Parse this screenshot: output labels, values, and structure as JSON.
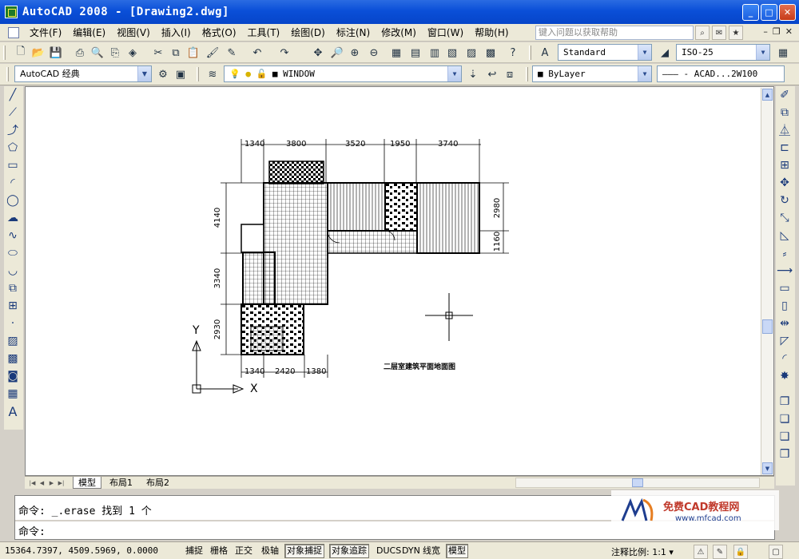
{
  "window": {
    "title": "AutoCAD 2008 - [Drawing2.dwg]",
    "min_glyph": "_",
    "max_glyph": "□",
    "close_glyph": "✕"
  },
  "menu": {
    "items": [
      "文件(F)",
      "编辑(E)",
      "视图(V)",
      "插入(I)",
      "格式(O)",
      "工具(T)",
      "绘图(D)",
      "标注(N)",
      "修改(M)",
      "窗口(W)",
      "帮助(H)"
    ],
    "help_placeholder": "键入问题以获取帮助",
    "doc_controls": [
      "–",
      "❐",
      "✕"
    ]
  },
  "toolbar1": {
    "text_style": "Standard",
    "dim_style": "ISO-25"
  },
  "toolbar2": {
    "workspace": "AutoCAD 经典",
    "layer": "WINDOW",
    "color": "ByLayer",
    "linetype": "——— - ACAD...2W100"
  },
  "drawing": {
    "top_dims": [
      "1340",
      "3800",
      "3520",
      "1950",
      "3740"
    ],
    "bottom_dims": [
      "1340",
      "2420",
      "1380"
    ],
    "left_dims": [
      "4140",
      "3340",
      "2930"
    ],
    "right_dims": [
      "2980",
      "1160"
    ],
    "plan_title": "二层室建筑平面地面图",
    "ucs_x": "X",
    "ucs_y": "Y"
  },
  "layout_tabs": [
    "模型",
    "布局1",
    "布局2"
  ],
  "command": {
    "line1": "命令:  _.erase 找到 1 个",
    "line2": "命令:"
  },
  "watermark": {
    "title": "免费CAD教程网",
    "url": "www.mfcad.com"
  },
  "status": {
    "coords": "15364.7397, 4509.5969, 0.0000",
    "toggles": [
      {
        "label": "捕捉",
        "on": false
      },
      {
        "label": "栅格",
        "on": false
      },
      {
        "label": "正交",
        "on": false
      },
      {
        "label": "极轴",
        "on": false
      },
      {
        "label": "对象捕捉",
        "on": true
      },
      {
        "label": "对象追踪",
        "on": true
      },
      {
        "label": "DUCS",
        "on": false
      },
      {
        "label": "DYN",
        "on": false
      },
      {
        "label": "线宽",
        "on": false
      },
      {
        "label": "模型",
        "on": true
      }
    ],
    "annotation_scale_label": "注释比例:",
    "annotation_scale": "1:1"
  },
  "colors": {
    "titlebar": "#0a4fd8",
    "chrome": "#ece9d8",
    "canvas": "#ffffff"
  }
}
